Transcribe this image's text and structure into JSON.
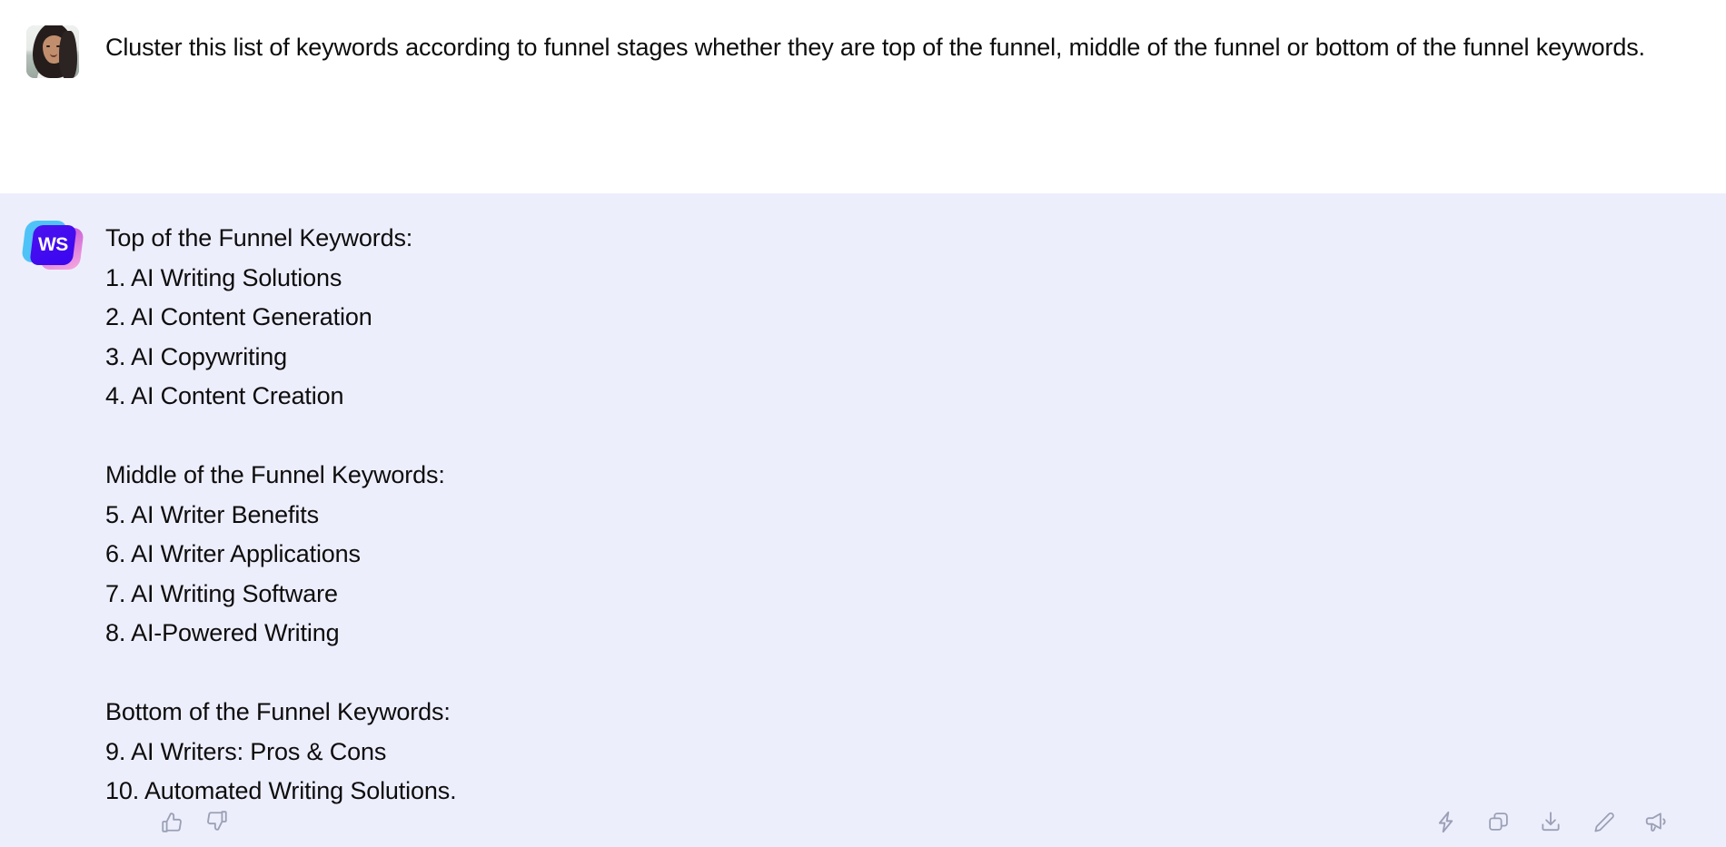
{
  "conversation": {
    "user_message": {
      "avatar_alt": "user-avatar-photo",
      "text": "Cluster this list of keywords according to funnel stages whether they are top of the funnel, middle of the funnel or bottom of the funnel keywords."
    },
    "assistant_message": {
      "logo_text": "WS",
      "sections": [
        {
          "heading": "Top of the Funnel Keywords:",
          "items": [
            "1. AI Writing Solutions",
            "2. AI Content Generation",
            "3. AI Copywriting",
            "4. AI Content Creation"
          ]
        },
        {
          "heading": "Middle of the Funnel Keywords:",
          "items": [
            "5. AI Writer Benefits",
            "6. AI Writer Applications",
            "7. AI Writing Software",
            "8. AI-Powered Writing"
          ]
        },
        {
          "heading": "Bottom of the Funnel Keywords:",
          "items": [
            "9. AI Writers: Pros & Cons",
            "10. Automated Writing Solutions."
          ]
        }
      ],
      "actions": {
        "left": [
          {
            "name": "thumbs-up-icon",
            "label": "Like"
          },
          {
            "name": "thumbs-down-icon",
            "label": "Dislike"
          }
        ],
        "right": [
          {
            "name": "lightning-bolt-icon",
            "label": "Improve"
          },
          {
            "name": "copy-icon",
            "label": "Copy"
          },
          {
            "name": "download-icon",
            "label": "Download"
          },
          {
            "name": "pencil-icon",
            "label": "Edit"
          },
          {
            "name": "megaphone-icon",
            "label": "Announce"
          }
        ]
      }
    }
  },
  "colors": {
    "assistant_bubble_bg": "#edeefc",
    "user_bubble_bg": "#ffffff",
    "text": "#0d0d0d",
    "icon": "#9aa0b5",
    "brand_blue": "#3a06f0",
    "brand_cyan": "#4fc3f7",
    "brand_pink": "#f6a8df"
  }
}
